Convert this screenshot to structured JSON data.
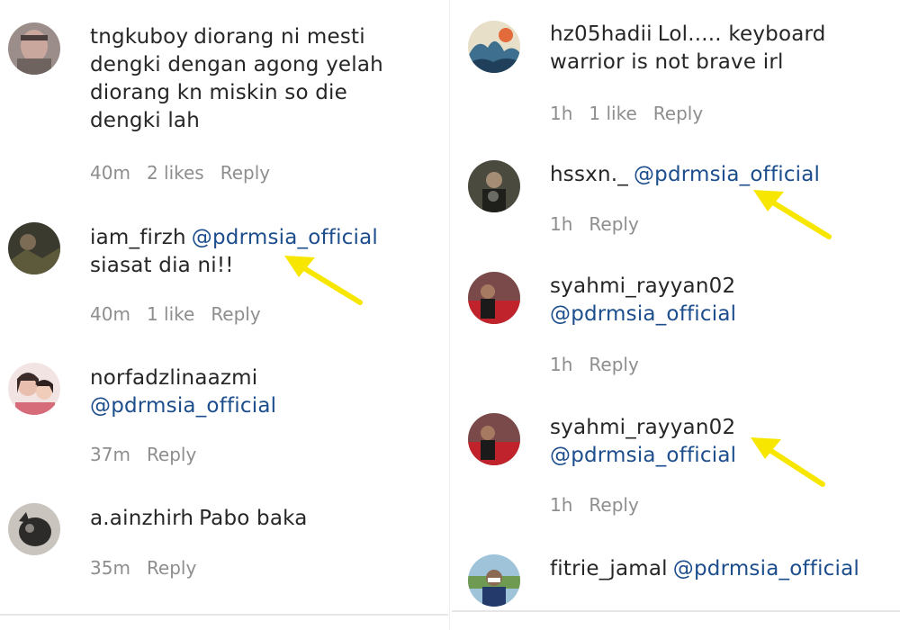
{
  "colors": {
    "mention": "#1c4d8c",
    "meta": "#8e8e8e",
    "arrow": "#f7e600"
  },
  "left": [
    {
      "username": "tngkuboy",
      "line1": "diorang ni mesti",
      "more": [
        "dengki dengan agong yelah",
        "diorang kn miskin so die",
        "dengki lah"
      ],
      "time": "40m",
      "likes": "2 likes",
      "reply": "Reply"
    },
    {
      "username": "iam_firzh",
      "mention": "@pdrmsia_official",
      "line2": "siasat dia ni!!",
      "time": "40m",
      "likes": "1 like",
      "reply": "Reply"
    },
    {
      "username": "norfadzlinaazmi",
      "mention": "@pdrmsia_official",
      "time": "37m",
      "reply": "Reply"
    },
    {
      "username": "a.ainzhirh",
      "text": "Pabo baka",
      "time": "35m",
      "reply": "Reply"
    }
  ],
  "right": [
    {
      "username": "hz05hadii",
      "line1": "Lol..... keyboard",
      "line2": "warrior is not brave irl",
      "time": "1h",
      "likes": "1 like",
      "reply": "Reply"
    },
    {
      "username": "hssxn._",
      "mention": "@pdrmsia_official",
      "time": "1h",
      "reply": "Reply"
    },
    {
      "username": "syahmi_rayyan02",
      "mention": "@pdrmsia_official",
      "time": "1h",
      "reply": "Reply"
    },
    {
      "username": "syahmi_rayyan02",
      "mention": "@pdrmsia_official",
      "time": "1h",
      "reply": "Reply"
    },
    {
      "username": "fitrie_jamal",
      "mention": "@pdrmsia_official"
    }
  ]
}
